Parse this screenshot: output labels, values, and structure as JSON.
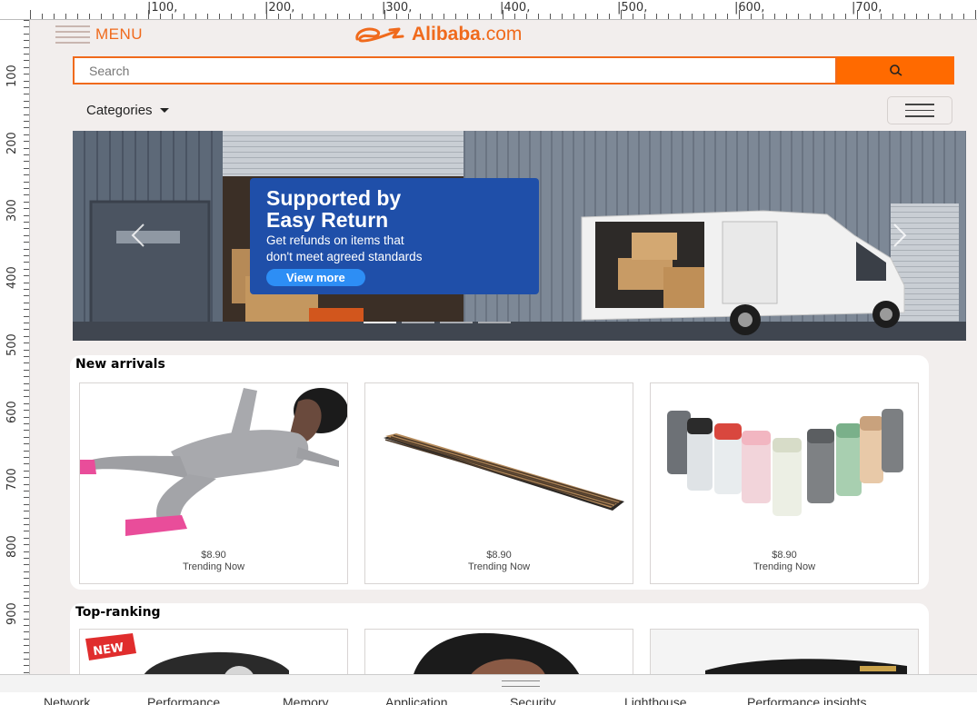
{
  "ruler": {
    "top_labels": [
      "|100,",
      "|200,",
      "|300,",
      "|400,",
      "|500,",
      "|600,",
      "|700,"
    ],
    "left_labels": [
      "100",
      "200",
      "300",
      "400",
      "500",
      "600",
      "700",
      "800",
      "900"
    ]
  },
  "header": {
    "menu_label": "MENU",
    "logo_text": "Alibaba",
    "logo_suffix": ".com",
    "brand_color": "#ff6a00"
  },
  "search": {
    "placeholder": "Search",
    "button_icon": "search-icon"
  },
  "nav": {
    "categories_label": "Categories",
    "toggler_icon": "hamburger-icon"
  },
  "banner": {
    "title_line1": "Supported by",
    "title_line2": "Easy Return",
    "subtitle_line1": "Get refunds on items that",
    "subtitle_line2": "don't meet agreed standards",
    "button_label": "View more",
    "prev_icon": "chevron-left-icon",
    "next_icon": "chevron-right-icon"
  },
  "new_arrivals": {
    "title": "New arrivals",
    "items": [
      {
        "price": "$8.90",
        "tag": "Trending Now",
        "image": "tracksuit-image"
      },
      {
        "price": "$8.90",
        "tag": "Trending Now",
        "image": "wood-slat-panel-image"
      },
      {
        "price": "$8.90",
        "tag": "Trending Now",
        "image": "spray-bottles-image"
      }
    ]
  },
  "top_ranking": {
    "title": "Top-ranking",
    "badge": "NEW",
    "items": [
      {
        "image": "watch-image"
      },
      {
        "image": "wig-image"
      },
      {
        "image": "sunglasses-image"
      }
    ]
  },
  "devtools": {
    "tabs": [
      "Network",
      "Performance",
      "Memory",
      "Application",
      "Security",
      "Lighthouse",
      "Performance insights"
    ]
  }
}
